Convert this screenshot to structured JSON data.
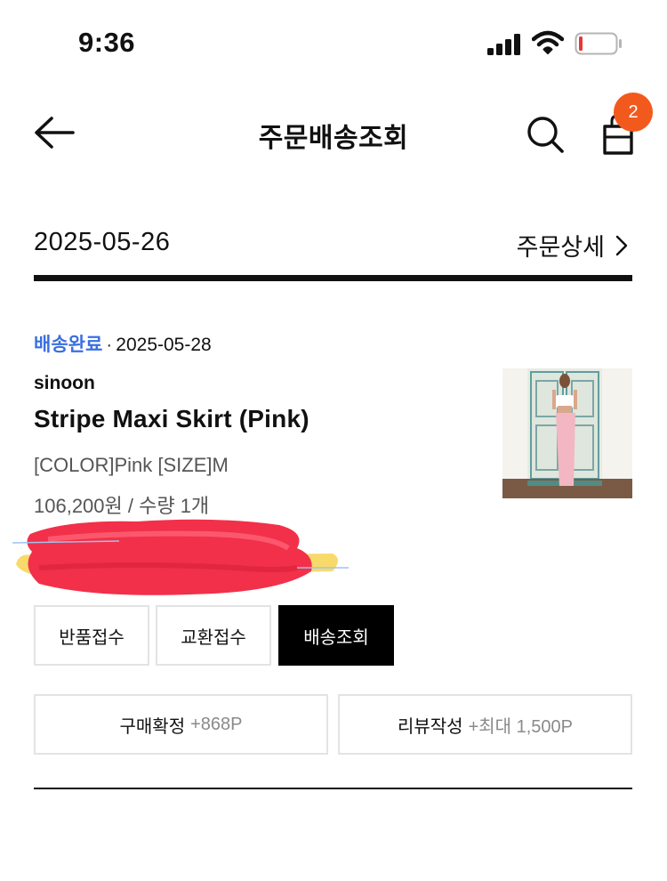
{
  "status_bar": {
    "time": "9:36"
  },
  "header": {
    "title": "주문배송조회",
    "cart_count": "2"
  },
  "order": {
    "date": "2025-05-26",
    "detail_label": "주문상세"
  },
  "item": {
    "status": "배송완료",
    "status_date": "2025-05-28",
    "brand": "sinoon",
    "name": "Stripe Maxi Skirt (Pink)",
    "option": "[COLOR]Pink [SIZE]M",
    "price_qty": "106,200원 / 수량 1개"
  },
  "actions": {
    "return_label": "반품접수",
    "exchange_label": "교환접수",
    "tracking_label": "배송조회",
    "confirm_label": "구매확정",
    "confirm_points": "+868P",
    "review_label": "리뷰작성",
    "review_points": "+최대 1,500P"
  },
  "colors": {
    "accent_blue": "#3a6fe2",
    "badge_orange": "#f25a1d",
    "battery_red": "#e53935",
    "redaction_red": "#f2304a"
  },
  "icons": {
    "back": "arrow-left-icon",
    "search": "search-icon",
    "bag": "shopping-bag-icon",
    "detail": "chevron-right-icon"
  }
}
